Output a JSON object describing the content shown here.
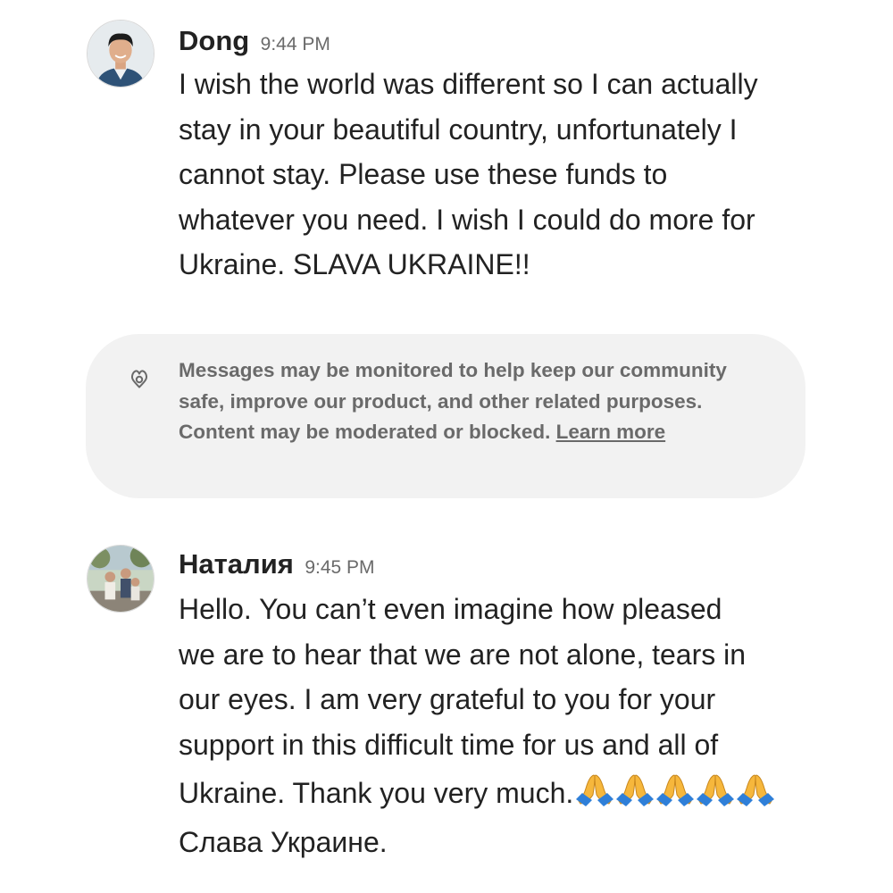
{
  "messages": [
    {
      "sender": "Dong",
      "time": "9:44 PM",
      "text": "I wish the world was different so I can actually\nstay in your beautiful country, unfortunately I\ncannot stay. Please use these funds to\nwhatever you need. I wish I could do more for\nUkraine. SLAVA UKRAINE!!"
    },
    {
      "sender": "Наталия",
      "time": "9:45 PM",
      "text": "Hello.  You can’t even imagine how pleased\nwe are to hear that we are not alone, tears in\nour eyes.  I am very grateful to you for your\nsupport in this difficult time for us and all of\nUkraine.  Thank you very much.",
      "emoji_count": 5,
      "text_after": "Слава Украине."
    }
  ],
  "notice": {
    "icon": "airbnb-logo-icon",
    "text": "Messages may be monitored to help keep our community safe, improve our product, and other related purposes. Content may be moderated or blocked.",
    "link_label": "Learn more"
  },
  "colors": {
    "text_primary": "#222222",
    "text_secondary": "#6a6a6a",
    "notice_background": "#f2f2f2",
    "emoji": "#f6b73c"
  },
  "icons": {
    "emoji": "folded-hands-icon"
  }
}
